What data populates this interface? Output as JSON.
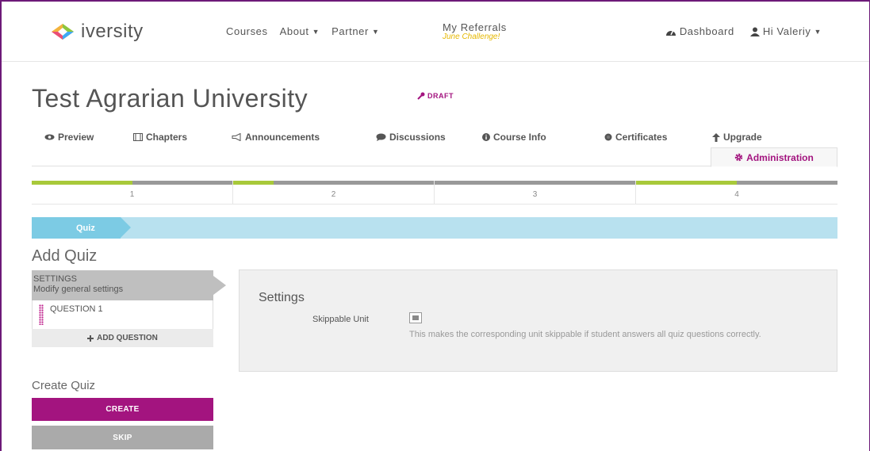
{
  "header": {
    "logo_text": "iversity",
    "nav": [
      {
        "label": "Courses",
        "caret": ""
      },
      {
        "label": "About",
        "caret": "▼"
      },
      {
        "label": "Partner",
        "caret": "▼"
      }
    ],
    "referrals": {
      "label": "My Referrals",
      "sub": "June Challenge!"
    },
    "dashboard_label": "Dashboard",
    "user_label": "Hi Valeriy",
    "user_caret": "▼"
  },
  "page": {
    "title": "Test Agrarian University",
    "draft_label": "DRAFT"
  },
  "tabs": {
    "preview": "Preview",
    "chapters": "Chapters",
    "announcements": "Announcements",
    "discussions": "Discussions",
    "course_info": "Course Info",
    "certificates": "Certificates",
    "upgrade": "Upgrade",
    "administration": "Administration"
  },
  "steps": [
    {
      "number": "1",
      "progress": 0.5
    },
    {
      "number": "2",
      "progress": 0.2
    },
    {
      "number": "3",
      "progress": 0
    },
    {
      "number": "4",
      "progress": 0.5
    }
  ],
  "banner": {
    "label": "Quiz"
  },
  "add_quiz": {
    "title": "Add Quiz",
    "settings_title": "SETTINGS",
    "settings_sub": "Modify general settings",
    "question_label": "QUESTION 1",
    "add_question_label": "ADD QUESTION"
  },
  "settings_panel": {
    "title": "Settings",
    "skippable_label": "Skippable Unit",
    "help_text": "This makes the corresponding unit skippable if student answers all quiz questions correctly."
  },
  "create_quiz": {
    "title": "Create Quiz",
    "create_label": "CREATE",
    "skip_label": "SKIP"
  },
  "colors": {
    "brand": "#a3147f",
    "progress": "#a8c93a",
    "banner": "#b8e1ef",
    "banner_tab": "#7ccbe4"
  }
}
